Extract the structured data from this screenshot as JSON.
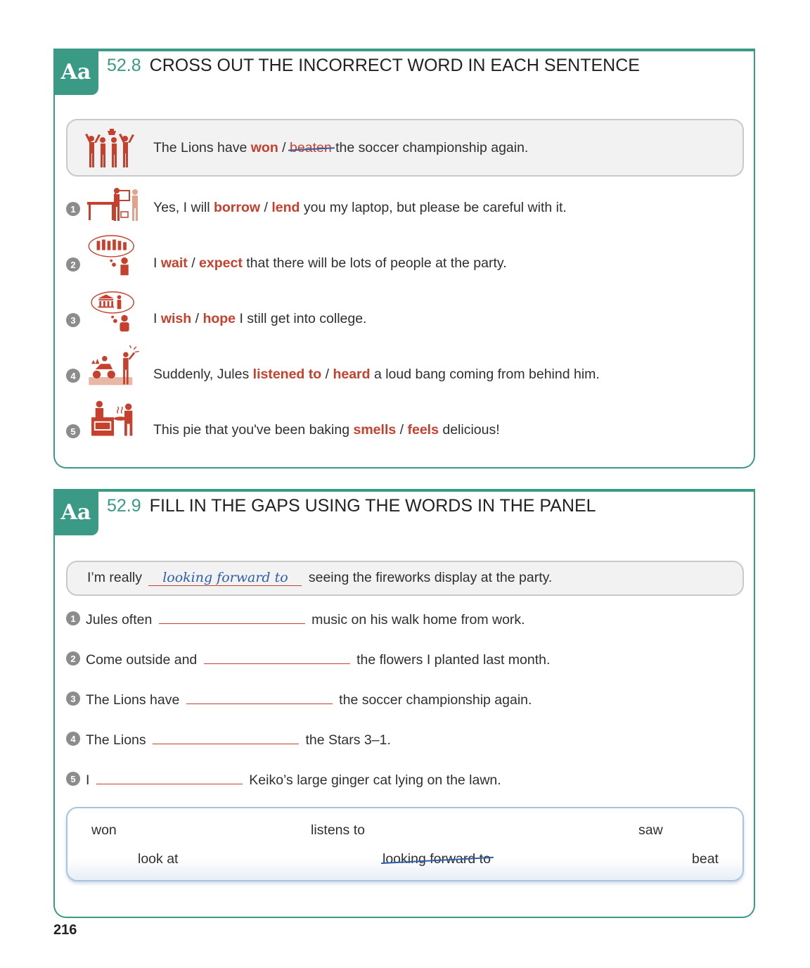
{
  "section1": {
    "badge": "Aa",
    "number": "52.8",
    "title": "CROSS OUT THE INCORRECT WORD IN EACH SENTENCE",
    "example": {
      "pre": "The Lions have ",
      "opt1": "won",
      "sep": " / ",
      "opt2": "beaten",
      "post": " the soccer championship again."
    },
    "items": [
      {
        "num": "1",
        "pre": "Yes, I will ",
        "opt1": "borrow",
        "sep": " / ",
        "opt2": "lend",
        "post": " you my laptop, but please be careful with it."
      },
      {
        "num": "2",
        "pre": "I ",
        "opt1": "wait",
        "sep": " / ",
        "opt2": "expect",
        "post": " that there will be lots of people at the party."
      },
      {
        "num": "3",
        "pre": "I ",
        "opt1": "wish",
        "sep": " / ",
        "opt2": "hope",
        "post": " I still get into college."
      },
      {
        "num": "4",
        "pre": "Suddenly, Jules ",
        "opt1": "listened to",
        "sep": " / ",
        "opt2": "heard",
        "post": " a loud bang coming from behind him."
      },
      {
        "num": "5",
        "pre": "This pie that you've been baking ",
        "opt1": "smells",
        "sep": " / ",
        "opt2": "feels",
        "post": " delicious!"
      }
    ]
  },
  "section2": {
    "badge": "Aa",
    "number": "52.9",
    "title": "FILL IN THE GAPS USING THE WORDS IN THE PANEL",
    "example": {
      "pre": "I’m really ",
      "answer": "looking forward to",
      "post": " seeing the fireworks display at the party."
    },
    "items": [
      {
        "num": "1",
        "pre": "Jules often ",
        "post": " music on his walk home from work."
      },
      {
        "num": "2",
        "pre": "Come outside and ",
        "post": " the flowers I planted last month."
      },
      {
        "num": "3",
        "pre": "The Lions have ",
        "post": " the soccer championship again."
      },
      {
        "num": "4",
        "pre": "The Lions ",
        "post": " the Stars 3–1."
      },
      {
        "num": "5",
        "pre": "I ",
        "post": " Keiko’s large ginger cat lying on the lawn."
      }
    ],
    "panel_words": [
      "won",
      "listens to",
      "saw",
      "look at",
      "looking forward to",
      "beat"
    ]
  },
  "page_number": "216"
}
